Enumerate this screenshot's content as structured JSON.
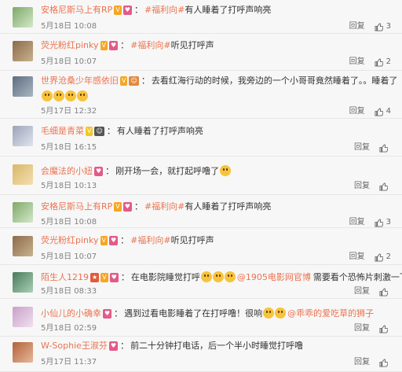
{
  "labels": {
    "reply": "回复"
  },
  "icons": {
    "like": "thumbs-up-icon"
  },
  "comments": [
    {
      "user": "安格尼斯马上有RP",
      "badges": [
        {
          "text": "V",
          "color": "#f6a623"
        },
        {
          "text": "♥",
          "color": "#e35a8b"
        }
      ],
      "tag": "#福利向#",
      "text": "有人睡着了打呼声响亮",
      "emojis": 0,
      "date": "5月18日 10:08",
      "likes": "3",
      "avatar_colors": [
        "#7ea86a",
        "#d4e8c9"
      ]
    },
    {
      "user": "荧光粉红pinky",
      "badges": [
        {
          "text": "V",
          "color": "#f6a623"
        },
        {
          "text": "♥",
          "color": "#e35a8b"
        }
      ],
      "tag": "#福利向#",
      "text": "听见打呼声",
      "emojis": 0,
      "date": "5月18日 10:07",
      "likes": "2",
      "avatar_colors": [
        "#8c6a4a",
        "#c9b28e"
      ]
    },
    {
      "user": "世界沧桑少年感依旧",
      "badges": [
        {
          "text": "V",
          "color": "#f6a623"
        },
        {
          "text": "☺",
          "color": "#e38a3d"
        }
      ],
      "tag": "",
      "text": "去看红海行动的时候，我旁边的一个小哥哥竟然睡着了。。睡着了",
      "line2_emojis": 4,
      "emojis": 0,
      "date": "5月17日 12:32",
      "likes": "4",
      "avatar_colors": [
        "#5d6d7e",
        "#a9b6c2"
      ]
    },
    {
      "user": "毛细是青菜",
      "badges": [
        {
          "text": "V",
          "color": "#f6c623"
        },
        {
          "text": "☺",
          "color": "#555555"
        }
      ],
      "tag": "",
      "text": "有人睡着了打呼声响亮",
      "emojis": 0,
      "date": "5月18日 16:15",
      "likes": "",
      "avatar_colors": [
        "#9aa4b8",
        "#e0e4ee"
      ]
    },
    {
      "user": "会魔法的小妞",
      "badges": [
        {
          "text": "♥",
          "color": "#e35a8b"
        }
      ],
      "tag": "",
      "text": "刚开场一会，就打起呼噜了",
      "emojis": 1,
      "date": "5月18日 10:13",
      "likes": "",
      "avatar_colors": [
        "#d8b66a",
        "#f3e0b0"
      ]
    },
    {
      "user": "安格尼斯马上有RP",
      "badges": [
        {
          "text": "V",
          "color": "#f6a623"
        },
        {
          "text": "♥",
          "color": "#e35a8b"
        }
      ],
      "tag": "#福利向#",
      "text": "有人睡着了打呼声响亮",
      "emojis": 0,
      "date": "5月18日 10:08",
      "likes": "3",
      "avatar_colors": [
        "#7ea86a",
        "#d4e8c9"
      ]
    },
    {
      "user": "荧光粉红pinky",
      "badges": [
        {
          "text": "V",
          "color": "#f6a623"
        },
        {
          "text": "♥",
          "color": "#e35a8b"
        }
      ],
      "tag": "#福利向#",
      "text": "听见打呼声",
      "emojis": 0,
      "date": "5月18日 10:07",
      "likes": "2",
      "avatar_colors": [
        "#8c6a4a",
        "#c9b28e"
      ]
    },
    {
      "user": "陌生人1219",
      "badges": [
        {
          "text": "★",
          "color": "#e35a3a"
        },
        {
          "text": "V",
          "color": "#f6a623"
        },
        {
          "text": "♥",
          "color": "#e35a8b"
        }
      ],
      "tag": "",
      "text": "在电影院睡觉打呼",
      "emojis": 3,
      "mention": "@1905电影网官博",
      "text_after": "需要看个恐怖片刺激一下",
      "date": "5月18日 08:33",
      "likes": "",
      "avatar_colors": [
        "#4a7a5a",
        "#a9d0b4"
      ]
    },
    {
      "user": "小仙儿的小确幸",
      "badges": [
        {
          "text": "♥",
          "color": "#e35a8b"
        }
      ],
      "tag": "",
      "text": "遇到过看电影睡着了在打呼噜！很响",
      "emojis": 2,
      "mention": "@乖乖的爱吃草的狮子",
      "text_after": "",
      "date": "5月18日 02:59",
      "likes": "",
      "avatar_colors": [
        "#c9a0c8",
        "#f0e0ef"
      ]
    },
    {
      "user": "W-Sophie王淑芬",
      "badges": [
        {
          "text": "♥",
          "color": "#e35a8b"
        }
      ],
      "tag": "",
      "text": "前二十分钟打电话，后一个半小时睡觉打呼噜",
      "emojis": 0,
      "date": "5月17日 11:37",
      "likes": "",
      "avatar_colors": [
        "#b0623a",
        "#e8b89a"
      ]
    }
  ]
}
